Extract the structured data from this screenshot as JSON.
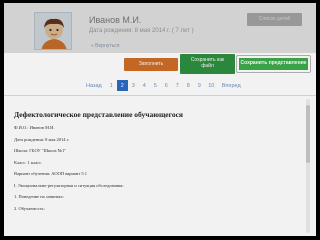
{
  "header": {
    "name": "Иванов М.И.",
    "birth": "Дата рождения: 8 мая 2014 г. ( 7 лет )",
    "back_link": "« Вернуться",
    "top_button": "Список детей"
  },
  "actions": {
    "fill": "Заполнить",
    "save_file": "Сохранить как\nфайл",
    "save_rep": "Сохранить представление"
  },
  "pager": {
    "prev": "Назад",
    "next": "Вперед",
    "pages": [
      "1",
      "2",
      "3",
      "4",
      "5",
      "6",
      "7",
      "8",
      "9",
      "10"
    ],
    "current": "2"
  },
  "document": {
    "title": "Дефектологическое представление обучающегося",
    "lines": [
      "Ф.И.О.: Иванов М.И.",
      "Дата рождения: 8 мая 2014 г.",
      "Школа: ГБОУ \"Школа №1\"",
      "Класс: 1 класс",
      "Вариант обучения: АООП вариант 5.1",
      "I. Эмоционально-регуляторная и ситуация обследования:",
      "1. Поведение на занятиях:",
      "2. Обучаемость:"
    ]
  },
  "colors": {
    "active_page": "#2d6cc0",
    "fill_button": "#cf6d28",
    "save_file_button": "#2e8f3f",
    "save_rep_button": "#3dab4a"
  }
}
